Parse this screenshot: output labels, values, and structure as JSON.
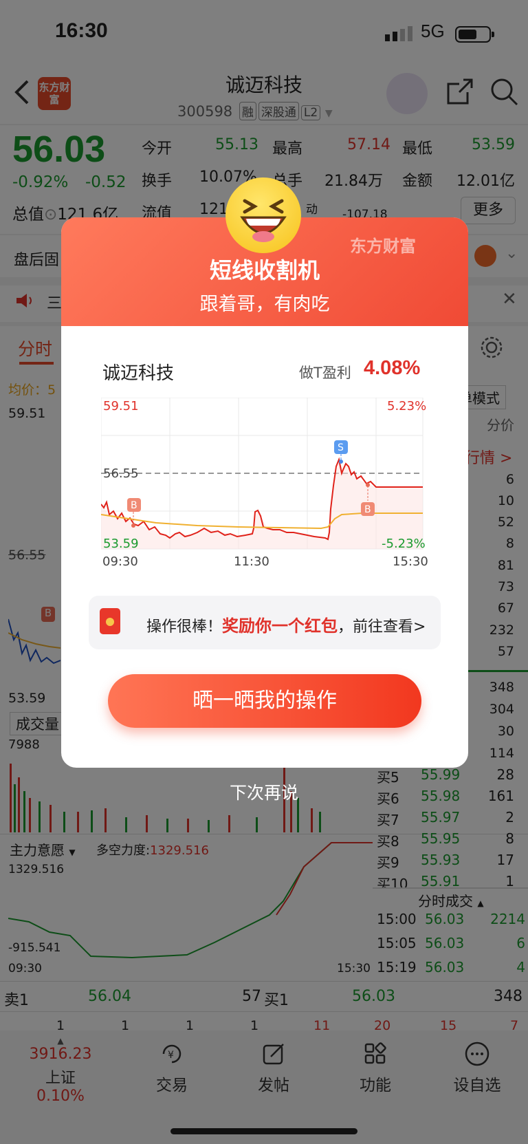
{
  "status_bar": {
    "time": "16:30",
    "network": "5G"
  },
  "header": {
    "back_icon": "chevron-left-icon",
    "logo_text": "东方财富",
    "stock_name": "诚迈科技",
    "stock_code": "300598",
    "tags": [
      "融",
      "深股通",
      "L2"
    ]
  },
  "quote": {
    "price": "56.03",
    "change_pct": "-0.92%",
    "change": "-0.52",
    "total_value_label": "总值",
    "total_value": "121.6亿",
    "open_label": "今开",
    "open": "55.13",
    "high_label": "最高",
    "high": "57.14",
    "low_label": "最低",
    "low": "53.59",
    "turnover_label": "换手",
    "turnover": "10.07%",
    "volume_label": "总手",
    "volume": "21.84万",
    "amount_label": "金额",
    "amount": "12.01亿",
    "float_label": "流值",
    "float_value": "121",
    "pe_label": "动",
    "pe_value": "-107.18",
    "more_label": "更多"
  },
  "background": {
    "after_hours_label": "盘后固",
    "news_label": "三",
    "tab_active": "分时",
    "avg_label": "均价：5",
    "chart_high": "59.51",
    "chart_mid": "56.55",
    "chart_low": "53.59",
    "volume_label": "成交量",
    "volume_max": "7988",
    "mode_label": "单模式",
    "price_col_label": "分价",
    "quote_link": "行情 >",
    "ask_sizes": [
      "6",
      "10",
      "52",
      "8",
      "81",
      "73",
      "67",
      "232",
      "57"
    ],
    "bid_sizes": [
      "348",
      "304",
      "30",
      "114"
    ],
    "bids": [
      {
        "label": "买5",
        "price": "55.99",
        "size": "28"
      },
      {
        "label": "买6",
        "price": "55.98",
        "size": "161"
      },
      {
        "label": "买7",
        "price": "55.97",
        "size": "2"
      },
      {
        "label": "买8",
        "price": "55.95",
        "size": "8"
      },
      {
        "label": "买9",
        "price": "55.93",
        "size": "17"
      },
      {
        "label": "买10",
        "price": "55.91",
        "size": "1"
      }
    ],
    "indicator_label": "主力意愿",
    "strength_label": "多空力度:",
    "strength_value": "1329.516",
    "ind_high": "1329.516",
    "ind_low": "-915.541",
    "time_start": "09:30",
    "time_end": "15:30",
    "ticks_title": "分时成交",
    "ticks": [
      {
        "time": "15:00",
        "price": "56.03",
        "vol": "2214"
      },
      {
        "time": "15:05",
        "price": "56.03",
        "vol": "6"
      },
      {
        "time": "15:19",
        "price": "56.03",
        "vol": "4"
      }
    ],
    "sell1_label": "卖1",
    "sell1_price": "56.04",
    "sell1_size": "57",
    "buy1_label": "买1",
    "buy1_price": "56.03",
    "buy1_size": "348",
    "row_left": [
      "1",
      "1",
      "1",
      "1"
    ],
    "row_right": [
      "11",
      "20",
      "15",
      "7"
    ]
  },
  "popup": {
    "brand": "东方财富",
    "title": "短线收割机",
    "subtitle": "跟着哥，有肉吃",
    "stock_name": "诚迈科技",
    "profit_label": "做T盈利",
    "profit_value": "4.08%",
    "chart_data": {
      "type": "line",
      "y_top": "59.51",
      "y_mid": "56.55",
      "y_bottom": "53.59",
      "pct_top": "5.23%",
      "pct_bottom": "-5.23%",
      "x_labels": [
        "09:30",
        "11:30",
        "15:30"
      ],
      "markers": [
        {
          "label": "B",
          "time": "09:55",
          "price": 54.31
        },
        {
          "label": "S",
          "time": "14:05",
          "price": 57.2
        },
        {
          "label": "B",
          "time": "14:20",
          "price": 55.9
        }
      ]
    },
    "reward_prefix": "操作很棒！",
    "reward_highlight": "奖励你一个红包",
    "reward_suffix": "，前往查看>",
    "share_button": "晒一晒我的操作",
    "dismiss": "下次再说"
  },
  "tabbar": {
    "index_value": "3916.23",
    "index_name": "上证",
    "index_change": "0.10%",
    "items": [
      "交易",
      "发帖",
      "功能",
      "设自选"
    ]
  }
}
